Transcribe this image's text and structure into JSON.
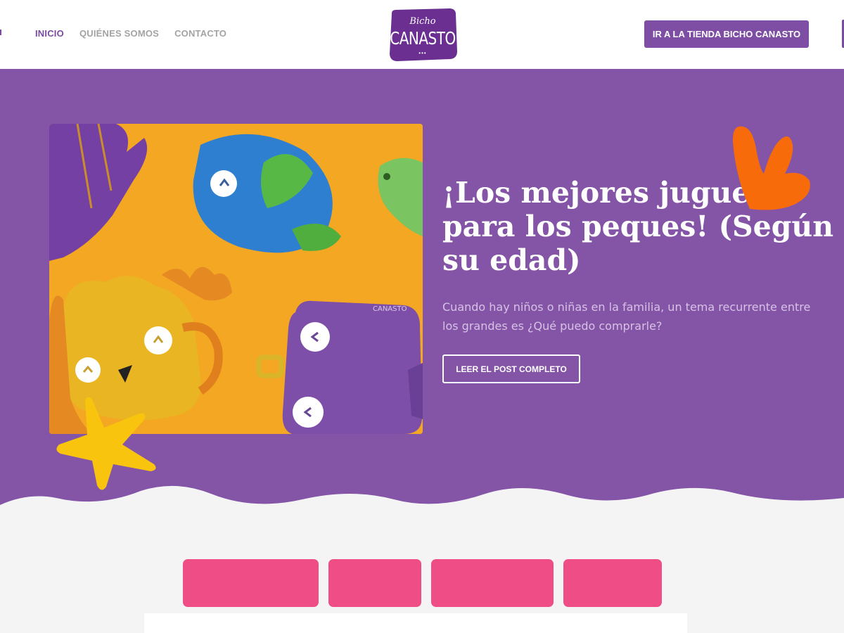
{
  "header": {
    "nav": [
      {
        "label": "INICIO",
        "active": true
      },
      {
        "label": "QUIÉNES SOMOS",
        "active": false
      },
      {
        "label": "CONTACTO",
        "active": false
      }
    ],
    "logo": {
      "top": "Bicho",
      "main": "CANASTO",
      "dots": "•••"
    },
    "store_button": "IR A LA TIENDA BICHO CANASTO"
  },
  "hero": {
    "title": "¡Los mejores juguetes para los peques! (Según su edad)",
    "description": "Cuando hay niños o niñas en la familia, un tema recurrente entre los grandes es ¿Qué puedo comprarle?",
    "read_button": "LEER EL POST COMPLETO",
    "image_label": "CANASTO"
  },
  "category_buttons": [
    "",
    "",
    "",
    ""
  ],
  "colors": {
    "brand_purple": "#8455a6",
    "button_purple": "#7d4ea3",
    "category_pink": "#ef4d85",
    "deco_orange": "#f76b0b",
    "deco_yellow": "#f8c40e"
  }
}
